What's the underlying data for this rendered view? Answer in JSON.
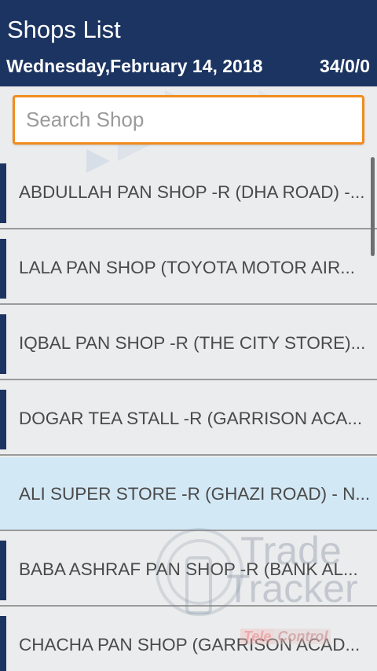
{
  "header": {
    "title": "Shops List",
    "date": "Wednesday,February 14, 2018",
    "count": "34/0/0"
  },
  "search": {
    "placeholder": "Search Shop",
    "value": ""
  },
  "shops": [
    {
      "name": "ABDULLAH PAN SHOP -R (DHA ROAD) -...",
      "selected": false
    },
    {
      "name": "LALA PAN SHOP (TOYOTA MOTOR AIR...",
      "selected": false
    },
    {
      "name": "IQBAL PAN SHOP -R (THE CITY STORE)...",
      "selected": false
    },
    {
      "name": "DOGAR TEA STALL -R (GARRISON ACA...",
      "selected": false
    },
    {
      "name": "ALI SUPER STORE -R (GHAZI ROAD) - N...",
      "selected": true
    },
    {
      "name": "BABA ASHRAF  PAN SHOP -R (BANK AL...",
      "selected": false
    },
    {
      "name": "CHACHA PAN SHOP (GARRISON ACAD...",
      "selected": false
    }
  ],
  "watermark": {
    "line1": "Trade",
    "line2": "Tracker",
    "badge_left": "Tele",
    "badge_right": "Control"
  },
  "colors": {
    "header_bg": "#1c3461",
    "search_border": "#f28c1e",
    "selected_row": "#d3e8f5",
    "accent": "#1c3461"
  }
}
